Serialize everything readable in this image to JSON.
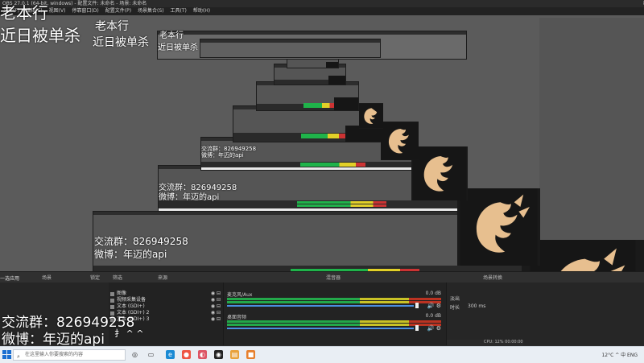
{
  "window": {
    "title": "OBS 27.0.1 (64-bit, windows) - 配置文件: 未命名 - 场景: 未命名",
    "controls": [
      "—",
      "☐",
      "✕"
    ]
  },
  "menubar": {
    "items": [
      "文件(F)",
      "编辑(E)",
      "视图(V)",
      "停靠窗口(D)",
      "配置文件(P)",
      "场景集合(S)",
      "工具(T)",
      "帮助(H)"
    ]
  },
  "overlay": {
    "top_line1": "老本行",
    "top_line2": "近日被单杀",
    "qq_group": "交流群：826949258",
    "weibo": "微博：年迈的api",
    "trailing_chars": "扌 ^ ^"
  },
  "docks": {
    "scenes_header": "场景",
    "sources_header": "来源",
    "mixer_header": "混音器",
    "transitions_header": "场景转换",
    "lock_label": "锁定",
    "scene_filter": "筛选",
    "scene_first": "一选应用"
  },
  "sources": [
    {
      "name": "图像",
      "icon": "image-icon"
    },
    {
      "name": "视频采集设备",
      "icon": "camera-icon"
    },
    {
      "name": "文本 (GDI+)",
      "icon": "text-icon"
    },
    {
      "name": "文本 (GDI+) 2",
      "icon": "text-icon"
    },
    {
      "name": "文本 (GDI+) 3",
      "icon": "text-icon"
    }
  ],
  "mixer": {
    "channels": [
      {
        "name": "麦克风/Aux",
        "db": "0.0 dB",
        "volume": 0.85
      },
      {
        "name": "桌面音频",
        "db": "0.0 dB",
        "volume": 0.85
      }
    ]
  },
  "transitions": {
    "type": "淡出",
    "duration_label": "时长",
    "duration_value": "300 ms"
  },
  "status": {
    "cpu": "CPU: 12%",
    "time": "00:00:00"
  },
  "taskbar": {
    "search_placeholder": "在这里输入你要搜索的内容",
    "weather": "12°C",
    "tray": "^ 中 ENG"
  },
  "colors": {
    "obs_bg": "#2b2b2b",
    "meter_green": "#23a84a",
    "meter_yellow": "#c9c226",
    "meter_red": "#b32",
    "logo_gold": "#e7bf8f"
  }
}
